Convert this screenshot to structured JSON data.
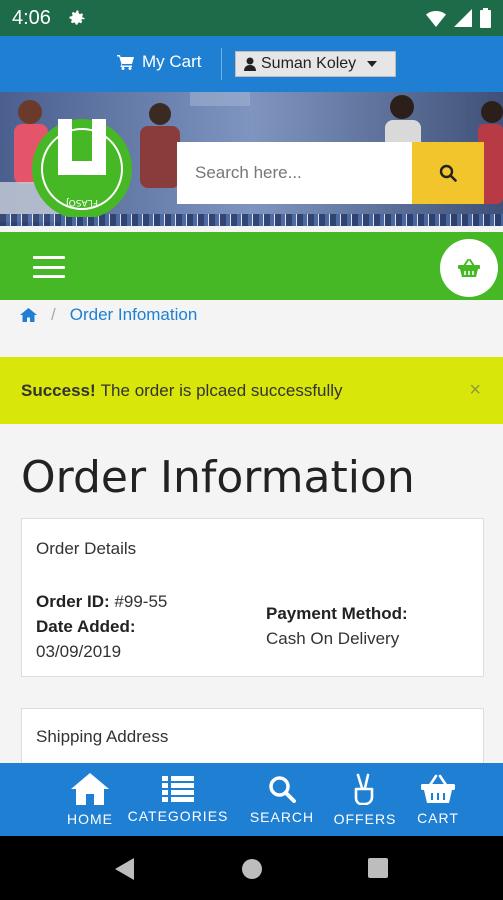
{
  "status_bar": {
    "time": "4:06",
    "icons": [
      "gear-icon",
      "wifi-icon",
      "signal-icon",
      "battery-icon"
    ]
  },
  "header": {
    "cart_label": "My Cart",
    "user_name": "Suman Koley",
    "icons": [
      "cart-icon",
      "user-icon",
      "chevron-down-icon"
    ]
  },
  "search": {
    "placeholder": "Search here...",
    "button_icon": "search-icon"
  },
  "nav": {
    "menu_icon": "hamburger-icon",
    "basket_icon": "basket-icon"
  },
  "breadcrumb": {
    "home_icon": "home-icon",
    "separator": "/",
    "current": "Order Infomation"
  },
  "alert": {
    "strong": "Success!",
    "message": "The order is plcaed successfully",
    "close": "×"
  },
  "page": {
    "title": "Order Information"
  },
  "order_details": {
    "title": "Order Details",
    "order_id_label": "Order ID:",
    "order_id_value": "#99-55",
    "date_label": "Date Added:",
    "date_value": "03/09/2019",
    "payment_label": "Payment Method:",
    "payment_value": "Cash On Delivery"
  },
  "shipping": {
    "title": "Shipping Address"
  },
  "bottom_nav": [
    {
      "label": "HOME",
      "icon": "home-icon"
    },
    {
      "label": "CATEGORIES",
      "icon": "list-icon"
    },
    {
      "label": "SEARCH",
      "icon": "search-icon"
    },
    {
      "label": "OFFERS",
      "icon": "hand-peace-icon"
    },
    {
      "label": "CART",
      "icon": "basket-icon"
    }
  ],
  "colors": {
    "status_bar": "#1d6b49",
    "header_blue": "#1e7fd3",
    "nav_green": "#47b825",
    "alert_yellow": "#d8e60a",
    "search_button": "#f2c52d"
  }
}
